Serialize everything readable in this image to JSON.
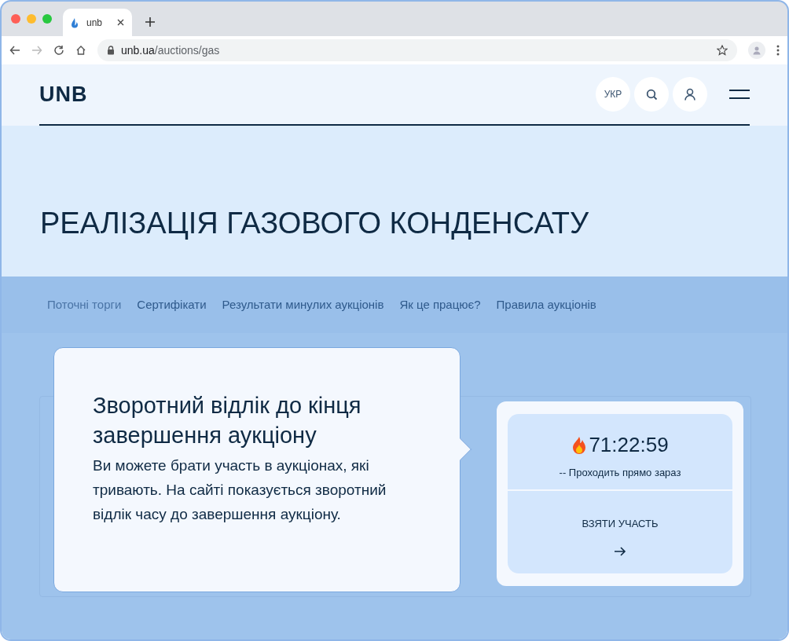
{
  "browser": {
    "tab_title": "unb",
    "url_host": "unb.ua",
    "url_path": "/auctions/gas"
  },
  "header": {
    "logo": "UNB",
    "language": "УКР"
  },
  "hero": {
    "title": "РЕАЛІЗАЦІЯ ГАЗОВОГО КОНДЕНСАТУ"
  },
  "nav_tabs": [
    {
      "label": "Поточні торги",
      "selected": true
    },
    {
      "label": "Сертифікати",
      "selected": false
    },
    {
      "label": "Результати минулих аукціонів",
      "selected": false
    },
    {
      "label": "Як це працює?",
      "selected": false
    },
    {
      "label": "Правила аукціонів",
      "selected": false
    }
  ],
  "tooltip": {
    "title": "Зворотний відлік до кінця завершення аукціону",
    "text": "Ви можете брати участь в аукціонах, які тривають. На сайті показується зворотний відлік часу до завершення аукціону."
  },
  "auction_card": {
    "timer": "71:22:59",
    "status": "-- Проходить прямо зараз",
    "action": "ВЗЯТИ УЧАСТЬ"
  }
}
